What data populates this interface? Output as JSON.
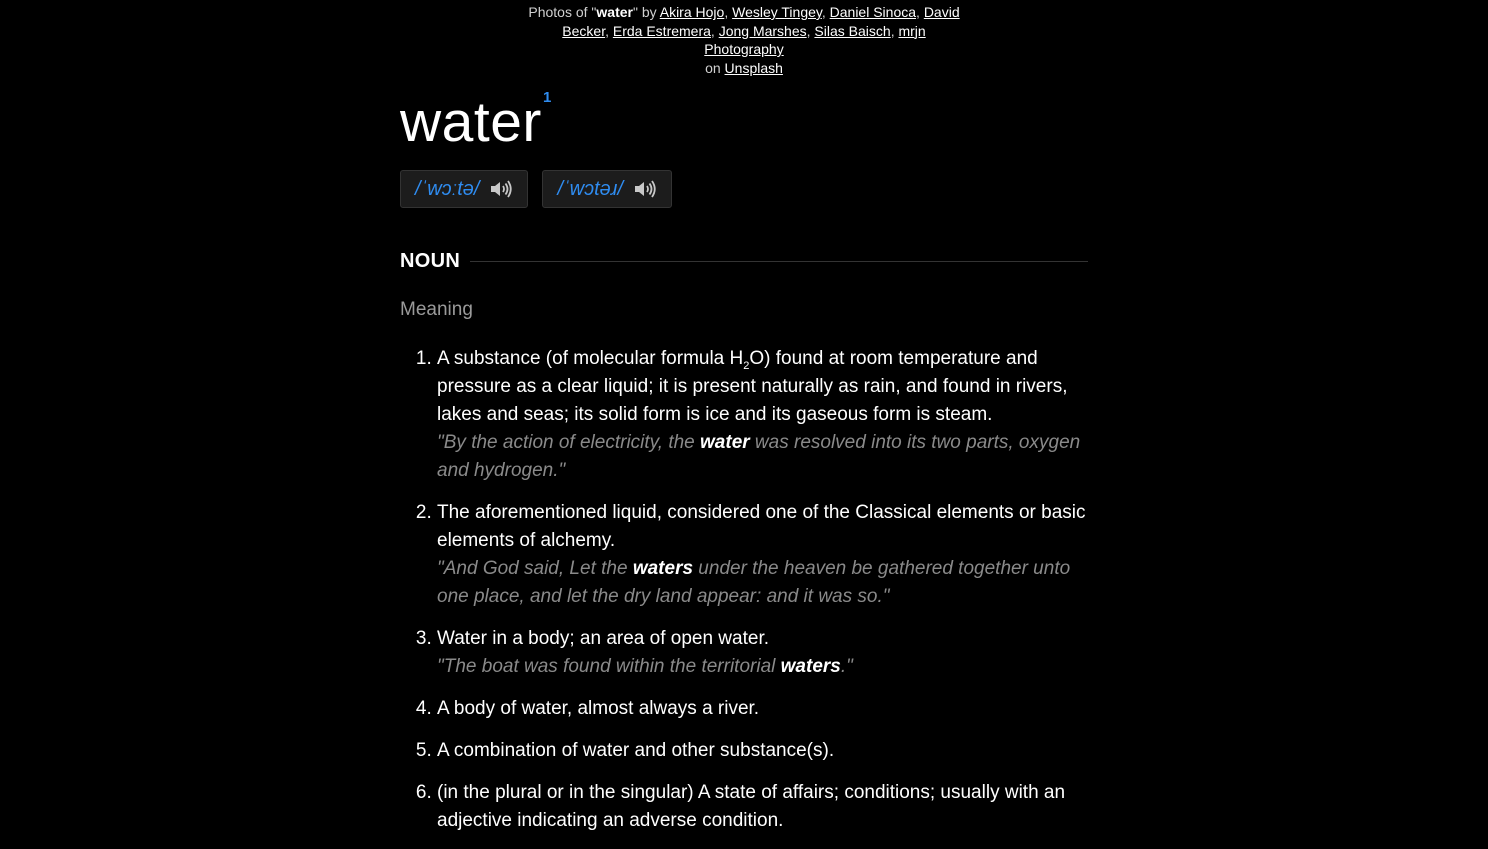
{
  "credits": {
    "prefix": "Photos of \"",
    "term": "water",
    "middle": "\" by ",
    "photographers": [
      "Akira Hojo",
      "Wesley Tingey",
      "Daniel Sinoca",
      "David Becker",
      "Erda Estremera",
      "Jong Marshes",
      "Silas Baisch",
      "mrjn Photography"
    ],
    "on_text": "on ",
    "site": "Unsplash"
  },
  "entry": {
    "word": "water",
    "superscript": "1",
    "pronunciations": [
      {
        "ipa": "/ˈwɔːtə/",
        "icon": "speaker-icon"
      },
      {
        "ipa": "/ˈwɔtəɹ/",
        "icon": "speaker-icon"
      }
    ],
    "part_of_speech": "NOUN",
    "meaning_label": "Meaning",
    "accent_color": "#2f8cf0",
    "definitions": [
      {
        "pre": "A substance (of molecular formula H",
        "sub": "2",
        "post": "O) found at room temperature and pressure as a clear liquid; it is present naturally as rain, and found in rivers, lakes and seas; its solid form is ice and its gaseous form is steam.",
        "example": {
          "before": "\"By the action of electricity, the ",
          "bold": "water",
          "after": " was resolved into its two parts, oxygen and hydrogen.\""
        }
      },
      {
        "text": "The aforementioned liquid, considered one of the Classical elements or basic elements of alchemy.",
        "example": {
          "before": "\"And God said, Let the ",
          "bold": "waters",
          "after": " under the heaven be gathered together unto one place, and let the dry land appear: and it was so.\""
        }
      },
      {
        "text": "Water in a body; an area of open water.",
        "example": {
          "before": "\"The boat was found within the territorial ",
          "bold": "waters",
          "after": ".\""
        }
      },
      {
        "text": "A body of water, almost always a river."
      },
      {
        "text": "A combination of water and other substance(s)."
      },
      {
        "text": "(in the plural or in the singular) A state of affairs; conditions; usually with an adjective indicating an adverse condition."
      }
    ]
  }
}
